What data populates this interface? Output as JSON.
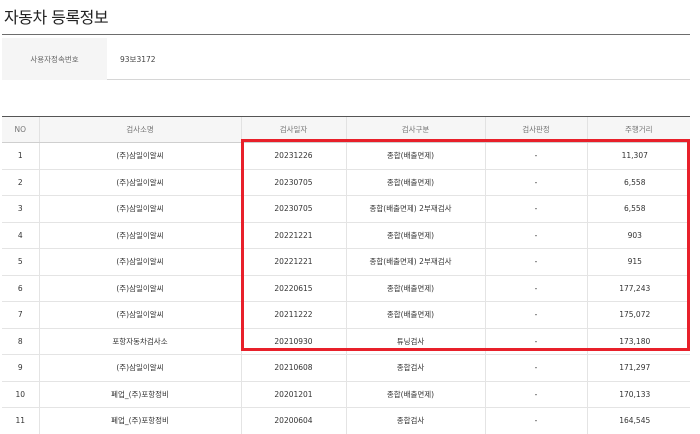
{
  "page": {
    "title": "자동차 등록정보"
  },
  "info": {
    "label": "사용자정속번호",
    "value": "93보3172"
  },
  "table": {
    "headers": [
      "NO",
      "검사소명",
      "검사일자",
      "검사구분",
      "검사판정",
      "주행거리"
    ],
    "rows": [
      [
        "1",
        "(주)삼일이알씨",
        "20231226",
        "종합(배출면제)",
        "-",
        "11,307"
      ],
      [
        "2",
        "(주)삼일이알씨",
        "20230705",
        "종합(배출면제)",
        "-",
        "6,558"
      ],
      [
        "3",
        "(주)삼일이알씨",
        "20230705",
        "종합(배출면제) 2부재검사",
        "-",
        "6,558"
      ],
      [
        "4",
        "(주)삼일이알씨",
        "20221221",
        "종합(배출면제)",
        "-",
        "903"
      ],
      [
        "5",
        "(주)삼일이알씨",
        "20221221",
        "종합(배출면제) 2부재검사",
        "-",
        "915"
      ],
      [
        "6",
        "(주)삼일이알씨",
        "20220615",
        "종합(배출면제)",
        "-",
        "177,243"
      ],
      [
        "7",
        "(주)삼일이알씨",
        "20211222",
        "종합(배출면제)",
        "-",
        "175,072"
      ],
      [
        "8",
        "포항자동차검사소",
        "20210930",
        "튜닝검사",
        "-",
        "173,180"
      ],
      [
        "9",
        "(주)삼일이알씨",
        "20210608",
        "종합검사",
        "-",
        "171,297"
      ],
      [
        "10",
        "폐업_(주)포항정비",
        "20201201",
        "종합(배출면제)",
        "-",
        "170,133"
      ],
      [
        "11",
        "폐업_(주)포항정비",
        "20200604",
        "종합검사",
        "-",
        "164,545"
      ]
    ]
  },
  "colors": {
    "highlight": "#e8202a",
    "header_bg": "#f6f6f6",
    "rule": "#555555"
  }
}
